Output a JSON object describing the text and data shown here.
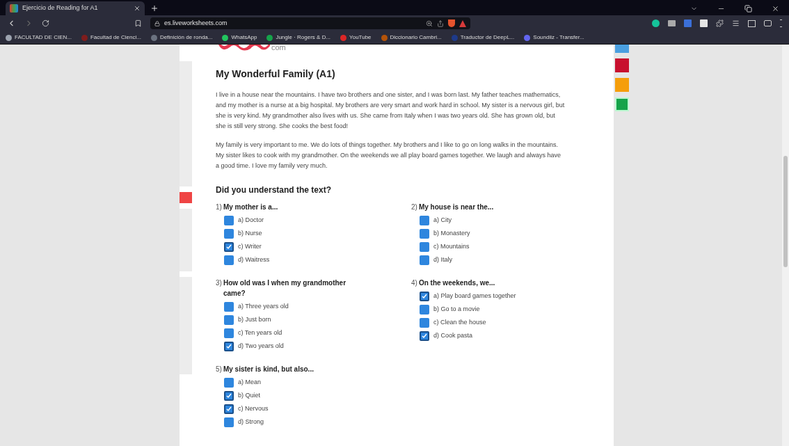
{
  "browser": {
    "tab_title": "Ejercicio de Reading for A1",
    "url_host": "es.liveworksheets.com",
    "bookmarks": [
      {
        "label": "FACULTAD DE CIEN...",
        "color": "#9ca3af"
      },
      {
        "label": "Facultad de Cienci...",
        "color": "#7f1d1d"
      },
      {
        "label": "Definición de ronda...",
        "color": "#6b7280"
      },
      {
        "label": "WhatsApp",
        "color": "#22c55e"
      },
      {
        "label": "Jungle · Rogers & D...",
        "color": "#16a34a"
      },
      {
        "label": "YouTube",
        "color": "#dc2626"
      },
      {
        "label": "Diccionario Cambri...",
        "color": "#b45309"
      },
      {
        "label": "Traductor de DeepL...",
        "color": "#1e3a8a"
      },
      {
        "label": "Soundiiz - Transfer...",
        "color": "#6366f1"
      }
    ]
  },
  "page": {
    "logo_suffix": "com",
    "title": "My Wonderful Family (A1)",
    "paragraphs": [
      "I live in a house near the mountains. I have two brothers and one sister, and I was born last. My father teaches mathematics, and my mother is a nurse at a big hospital. My brothers are very smart and work hard in school. My sister is a nervous girl, but she is very kind. My grandmother also lives with us. She came from Italy when I was two years old. She has grown old, but she is still very strong. She cooks the best food!",
      "My family is very important to me. We do lots of things together. My brothers and I like to go on long walks in the mountains. My sister likes to cook with my grandmother. On the weekends we all play board games together. We laugh and always have a good time. I love my family very much."
    ],
    "section_title": "Did you understand the text?",
    "questions": [
      {
        "number": "1)",
        "text": "My mother is a...",
        "options": [
          {
            "label": "a) Doctor",
            "checked": false
          },
          {
            "label": "b) Nurse",
            "checked": false
          },
          {
            "label": "c) Writer",
            "checked": true
          },
          {
            "label": "d) Waitress",
            "checked": false
          }
        ]
      },
      {
        "number": "2)",
        "text": "My house is near the...",
        "options": [
          {
            "label": "a) City",
            "checked": false
          },
          {
            "label": "b) Monastery",
            "checked": false
          },
          {
            "label": "c) Mountains",
            "checked": false
          },
          {
            "label": "d) Italy",
            "checked": false
          }
        ]
      },
      {
        "number": "3)",
        "text": "How old was I when my grandmother came?",
        "options": [
          {
            "label": "a) Three years old",
            "checked": false
          },
          {
            "label": "b) Just born",
            "checked": false
          },
          {
            "label": "c) Ten years old",
            "checked": false
          },
          {
            "label": "d) Two years old",
            "checked": true
          }
        ]
      },
      {
        "number": "4)",
        "text": "On the weekends, we...",
        "options": [
          {
            "label": "a) Play board games together",
            "checked": true
          },
          {
            "label": "b) Go to a movie",
            "checked": false
          },
          {
            "label": "c) Clean the house",
            "checked": false
          },
          {
            "label": "d) Cook pasta",
            "checked": true
          }
        ]
      },
      {
        "number": "5)",
        "text": "My sister is kind, but also...",
        "options": [
          {
            "label": "a) Mean",
            "checked": false
          },
          {
            "label": "b) Quiet",
            "checked": true
          },
          {
            "label": "c) Nervous",
            "checked": true
          },
          {
            "label": "d) Strong",
            "checked": false
          }
        ]
      }
    ]
  }
}
